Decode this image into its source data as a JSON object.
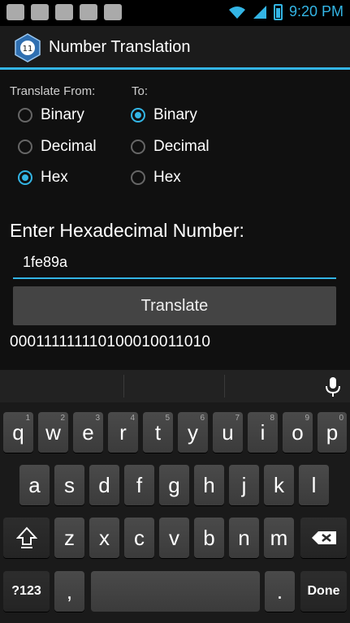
{
  "status_bar": {
    "time": "9:20 PM",
    "notification_icons": [
      "mail-icon",
      "sms-icon",
      "usb-icon",
      "android-icon",
      "clipboard-icon"
    ],
    "accent": "#33b5e5"
  },
  "app_bar": {
    "title": "Number Translation"
  },
  "form": {
    "translate_from_label": "Translate From:",
    "to_label": "To:",
    "from_options": [
      "Binary",
      "Decimal",
      "Hex"
    ],
    "from_selected": "Hex",
    "to_options": [
      "Binary",
      "Decimal",
      "Hex"
    ],
    "to_selected": "Binary",
    "enter_prompt": "Enter Hexadecimal Number:",
    "input_value": "1fe89a",
    "translate_button": "Translate",
    "result": "000111111110100010011010"
  },
  "keyboard": {
    "row1": [
      {
        "k": "q",
        "h": "1"
      },
      {
        "k": "w",
        "h": "2"
      },
      {
        "k": "e",
        "h": "3"
      },
      {
        "k": "r",
        "h": "4"
      },
      {
        "k": "t",
        "h": "5"
      },
      {
        "k": "y",
        "h": "6"
      },
      {
        "k": "u",
        "h": "7"
      },
      {
        "k": "i",
        "h": "8"
      },
      {
        "k": "o",
        "h": "9"
      },
      {
        "k": "p",
        "h": "0"
      }
    ],
    "row2": [
      "a",
      "s",
      "d",
      "f",
      "g",
      "h",
      "j",
      "k",
      "l"
    ],
    "row3": [
      "z",
      "x",
      "c",
      "v",
      "b",
      "n",
      "m"
    ],
    "sym_label": "?123",
    "comma_label": ",",
    "period_label": ".",
    "done_label": "Done"
  }
}
